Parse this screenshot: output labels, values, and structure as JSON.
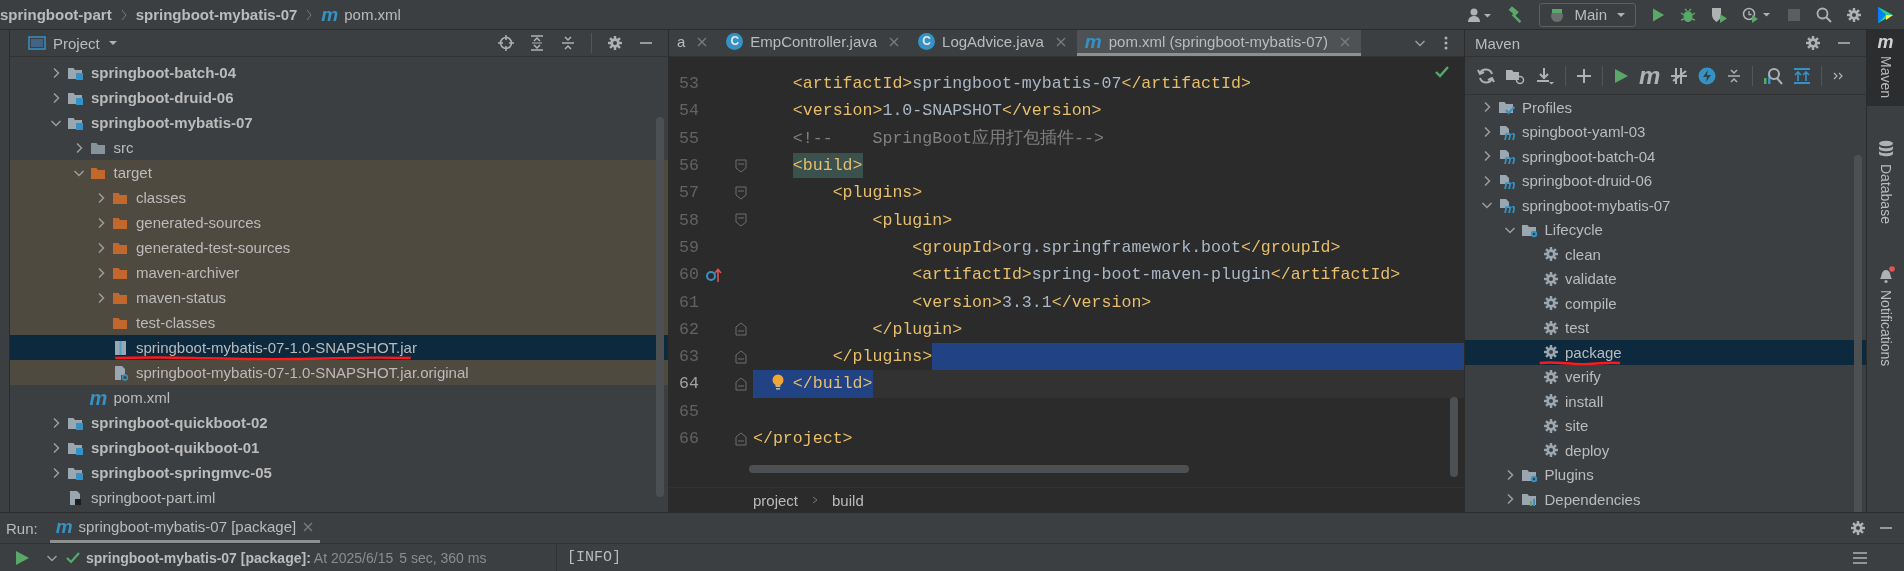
{
  "title_bar": {
    "breadcrumbs": [
      {
        "label": "springboot-part"
      },
      {
        "label": "springboot-mybatis-07"
      },
      {
        "label": "pom.xml",
        "glyph": "m"
      }
    ],
    "run_config": "Main"
  },
  "project_panel": {
    "title": "Project",
    "items": [
      {
        "label": "springboot-batch-04",
        "kind": "module",
        "expanded": false,
        "selected": false,
        "excluded": false,
        "underlined": false
      },
      {
        "label": "springboot-druid-06",
        "kind": "module",
        "expanded": false,
        "selected": false,
        "excluded": false,
        "underlined": false
      },
      {
        "label": "springboot-mybatis-07",
        "kind": "module",
        "expanded": true,
        "selected": false,
        "excluded": false,
        "underlined": false,
        "children": [
          {
            "label": "src",
            "kind": "folder",
            "expanded": false,
            "selected": false,
            "excluded": false,
            "underlined": false
          },
          {
            "label": "target",
            "kind": "output-folder",
            "expanded": true,
            "selected": false,
            "excluded": true,
            "underlined": false,
            "children": [
              {
                "label": "classes",
                "kind": "output-folder",
                "expanded": false,
                "selected": false,
                "excluded": true,
                "underlined": false
              },
              {
                "label": "generated-sources",
                "kind": "output-folder",
                "expanded": false,
                "selected": false,
                "excluded": true,
                "underlined": false
              },
              {
                "label": "generated-test-sources",
                "kind": "output-folder",
                "expanded": false,
                "selected": false,
                "excluded": true,
                "underlined": false
              },
              {
                "label": "maven-archiver",
                "kind": "output-folder",
                "expanded": false,
                "selected": false,
                "excluded": true,
                "underlined": false
              },
              {
                "label": "maven-status",
                "kind": "output-folder",
                "expanded": false,
                "selected": false,
                "excluded": true,
                "underlined": false
              },
              {
                "label": "test-classes",
                "kind": "output-folder",
                "selected": false,
                "excluded": true,
                "underlined": false
              },
              {
                "label": "springboot-mybatis-07-1.0-SNAPSHOT.jar",
                "kind": "jar",
                "selected": true,
                "excluded": true,
                "underlined": true
              },
              {
                "label": "springboot-mybatis-07-1.0-SNAPSHOT.jar.original",
                "kind": "unknown",
                "selected": false,
                "excluded": true,
                "underlined": false
              }
            ]
          },
          {
            "label": "pom.xml",
            "kind": "pom",
            "glyph": "m",
            "selected": false,
            "excluded": false,
            "underlined": false
          }
        ]
      },
      {
        "label": "springboot-quickboot-02",
        "kind": "module",
        "expanded": false,
        "selected": false,
        "excluded": false,
        "underlined": false
      },
      {
        "label": "springboot-quikboot-01",
        "kind": "module",
        "expanded": false,
        "selected": false,
        "excluded": false,
        "underlined": false
      },
      {
        "label": "springboot-springmvc-05",
        "kind": "module",
        "expanded": false,
        "selected": false,
        "excluded": false,
        "underlined": false
      },
      {
        "label": "springboot-part.iml",
        "kind": "iml",
        "selected": false,
        "excluded": false,
        "underlined": false
      }
    ]
  },
  "editor": {
    "tabs": [
      {
        "label": "a",
        "selected": false
      },
      {
        "label": "EmpController.java",
        "glyph": "C",
        "selected": false
      },
      {
        "label": "LogAdvice.java",
        "glyph": "C",
        "selected": false
      },
      {
        "label": "pom.xml (springboot-mybatis-07)",
        "glyph": "m",
        "selected": true
      }
    ],
    "lines": [
      {
        "children": [
          {
            "number": "53",
            "parts": [
              {
                "kind": "tag",
                "text": "<artifactId>"
              },
              {
                "kind": "text",
                "text": "springboot-mybatis-07"
              },
              {
                "kind": "tag",
                "text": "</artifactId>"
              }
            ]
          },
          {
            "number": "54",
            "parts": [
              {
                "kind": "tag",
                "text": "<version>"
              },
              {
                "kind": "text",
                "text": "1.0-SNAPSHOT"
              },
              {
                "kind": "tag",
                "text": "</version>"
              }
            ]
          },
          {
            "number": "55",
            "parts": [
              {
                "kind": "comment",
                "text": "<!--    SpringBoot应用打包插件-->"
              }
            ]
          },
          {
            "number": "56",
            "fold_open": true,
            "parts": [
              {
                "kind": "tag",
                "text": "<build>",
                "match": true
              }
            ],
            "children": [
              {
                "number": "57",
                "fold_open": true,
                "parts": [
                  {
                    "kind": "tag",
                    "text": "<plugins>"
                  }
                ],
                "children": [
                  {
                    "number": "58",
                    "fold_open": true,
                    "parts": [
                      {
                        "kind": "tag",
                        "text": "<plugin>"
                      }
                    ],
                    "children": [
                      {
                        "number": "59",
                        "parts": [
                          {
                            "kind": "tag",
                            "text": "<groupId>"
                          },
                          {
                            "kind": "text",
                            "text": "org.springframework.boot"
                          },
                          {
                            "kind": "tag",
                            "text": "</groupId>"
                          }
                        ]
                      },
                      {
                        "number": "60",
                        "overridden": true,
                        "parts": [
                          {
                            "kind": "tag",
                            "text": "<artifactId>"
                          },
                          {
                            "kind": "text",
                            "text": "spring-boot-maven-plugin"
                          },
                          {
                            "kind": "tag",
                            "text": "</artifactId>"
                          }
                        ]
                      },
                      {
                        "number": "61",
                        "parts": [
                          {
                            "kind": "tag",
                            "text": "<version>"
                          },
                          {
                            "kind": "text",
                            "text": "3.3.1"
                          },
                          {
                            "kind": "tag",
                            "text": "</version>"
                          }
                        ]
                      }
                    ]
                  },
                  {
                    "number": "62",
                    "fold_close": true,
                    "parts": [
                      {
                        "kind": "tag",
                        "text": "</plugin>"
                      }
                    ]
                  }
                ]
              },
              {
                "number": "63",
                "fold_close": true,
                "selection_tail": true,
                "parts": [
                  {
                    "kind": "tag",
                    "text": "</plugins>"
                  }
                ]
              }
            ]
          },
          {
            "number": "64",
            "fold_close": true,
            "selected": true,
            "current": true,
            "bulb": true,
            "parts": [
              {
                "kind": "tag",
                "text": "</build>"
              }
            ]
          },
          {
            "number": "65"
          }
        ]
      },
      {
        "number": "66",
        "fold_close": true,
        "parts": [
          {
            "kind": "tag",
            "text": "</project>"
          }
        ]
      }
    ],
    "breadcrumbs": [
      "project",
      "build"
    ]
  },
  "maven_panel": {
    "title": "Maven",
    "toolbar_glyph": "m",
    "items": [
      {
        "label": "Profiles",
        "kind": "profiles",
        "expanded": false,
        "selected": false,
        "underlined": false
      },
      {
        "label": "spingboot-yaml-03",
        "kind": "module",
        "glyph": "m",
        "expanded": false,
        "selected": false,
        "underlined": false
      },
      {
        "label": "springboot-batch-04",
        "kind": "module",
        "glyph": "m",
        "expanded": false,
        "selected": false,
        "underlined": false
      },
      {
        "label": "springboot-druid-06",
        "kind": "module",
        "glyph": "m",
        "expanded": false,
        "selected": false,
        "underlined": false
      },
      {
        "label": "springboot-mybatis-07",
        "kind": "module",
        "glyph": "m",
        "expanded": true,
        "selected": false,
        "underlined": false,
        "children": [
          {
            "label": "Lifecycle",
            "kind": "lifecycle",
            "expanded": true,
            "selected": false,
            "underlined": false,
            "children": [
              {
                "label": "clean",
                "kind": "goal",
                "selected": false,
                "underlined": false
              },
              {
                "label": "validate",
                "kind": "goal",
                "selected": false,
                "underlined": false
              },
              {
                "label": "compile",
                "kind": "goal",
                "selected": false,
                "underlined": false
              },
              {
                "label": "test",
                "kind": "goal",
                "selected": false,
                "underlined": false
              },
              {
                "label": "package",
                "kind": "goal",
                "selected": true,
                "underlined": true
              },
              {
                "label": "verify",
                "kind": "goal",
                "selected": false,
                "underlined": false
              },
              {
                "label": "install",
                "kind": "goal",
                "selected": false,
                "underlined": false
              },
              {
                "label": "site",
                "kind": "goal",
                "selected": false,
                "underlined": false
              },
              {
                "label": "deploy",
                "kind": "goal",
                "selected": false,
                "underlined": false
              }
            ]
          },
          {
            "label": "Plugins",
            "kind": "plugins",
            "expanded": false,
            "selected": false,
            "underlined": false
          },
          {
            "label": "Dependencies",
            "kind": "dependencies",
            "expanded": false,
            "selected": false,
            "underlined": false
          }
        ]
      }
    ]
  },
  "tool_strip": [
    {
      "label": "Maven",
      "kind": "maven",
      "glyph": "m",
      "selected": true
    },
    {
      "label": "Database",
      "kind": "database",
      "selected": false
    },
    {
      "label": "Notifications",
      "kind": "bell",
      "selected": false,
      "unread": true
    }
  ],
  "run_panel": {
    "title": "Run:",
    "tabs": [
      {
        "label": "springboot-mybatis-07 [package]",
        "glyph": "m",
        "selected": true
      }
    ],
    "tree": [
      {
        "label": "springboot-mybatis-07 [package]:",
        "time": "At 2025/6/15",
        "duration": "5 sec, 360 ms",
        "succeeded": true,
        "expanded": true
      }
    ],
    "console": [
      "[INFO]"
    ]
  }
}
